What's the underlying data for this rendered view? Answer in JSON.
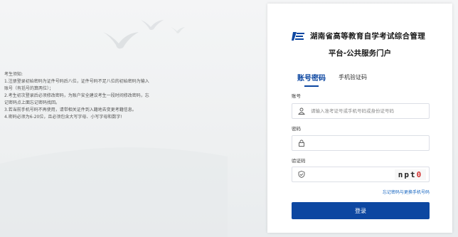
{
  "notice": {
    "title": "考生须知:",
    "lines": [
      "1.注册登录初始密码为证件号码后八位，证件号码不足八位的初始密码为输入",
      "账号（有括号的算两位）；",
      "2.考生初次登录后必须修改密码，为账户安全建议考生一段时间修改密码，忘",
      "记密码点上面忘记密码找回。",
      "3.若当前手机号码不再使用，请带相关证件到入籍地去变更考籍信息。",
      "4.密码必须为6-20位，且必须包含大写字母、小写字母和数字!"
    ]
  },
  "header": {
    "logo_icon": "exam-logo-icon",
    "title_line1": "湖南省高等教育自学考试综合管理",
    "title_line2": "平台-公共服务门户"
  },
  "tabs": [
    {
      "label": "账号密码",
      "active": true
    },
    {
      "label": "手机验证码",
      "active": false
    }
  ],
  "form": {
    "account_label": "账号",
    "account_placeholder": "请输入准考证号或手机号码或身份证号码",
    "account_icon": "user-icon",
    "password_label": "密码",
    "password_placeholder": "",
    "password_icon": "lock-icon",
    "captcha_label": "验证码",
    "captcha_placeholder": "",
    "captcha_icon": "shield-check-icon",
    "captcha_text_dark": "npt",
    "captcha_text_red": "0"
  },
  "forgot_link": "忘记密码与更换手机号码",
  "login_button": "登录",
  "colors": {
    "primary": "#0d47a1",
    "link": "#1565c0",
    "captcha_accent": "#d32f2f"
  }
}
